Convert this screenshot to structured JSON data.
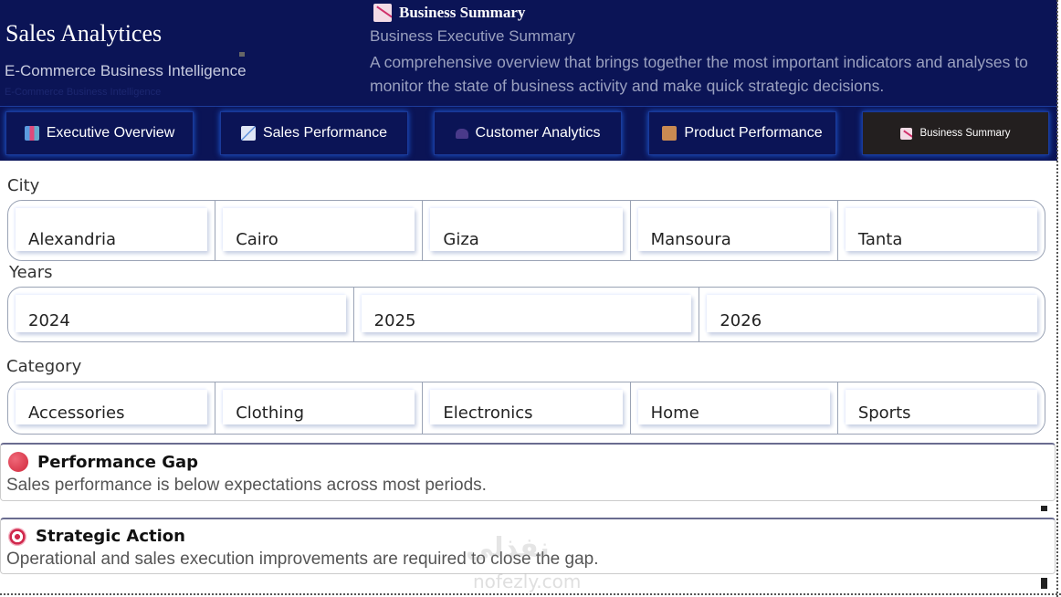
{
  "header": {
    "title": "Sales Analytices",
    "subtitle": "E-Commerce Business Intelligence",
    "subtitle_shadow": "E-Commerce Business Intelligence",
    "summary_title": "Business Summary",
    "summary_subtitle": "Business Executive Summary",
    "summary_description": "A comprehensive overview that brings together the most important indicators and analyses to monitor the state of business activity and make quick strategic decisions."
  },
  "nav": {
    "tabs": [
      {
        "label": "Executive Overview",
        "icon": "bar-chart-icon"
      },
      {
        "label": "Sales Performance",
        "icon": "line-chart-icon"
      },
      {
        "label": "Customer Analytics",
        "icon": "users-icon"
      },
      {
        "label": "Product Performance",
        "icon": "package-icon"
      },
      {
        "label": "Business Summary",
        "icon": "chart-decreasing-icon",
        "active": true
      }
    ]
  },
  "slicers": {
    "city": {
      "label": "City",
      "options": [
        "Alexandria",
        "Cairo",
        "Giza",
        "Mansoura",
        "Tanta"
      ]
    },
    "years": {
      "label": "Years",
      "options": [
        "2024",
        "2025",
        "2026"
      ]
    },
    "category": {
      "label": "Category",
      "options": [
        "Accessories",
        "Clothing",
        "Electronics",
        "Home",
        "Sports"
      ]
    }
  },
  "cards": [
    {
      "title": "Performance Gap",
      "icon": "red-circle-icon",
      "text": "Sales performance is below expectations across most periods."
    },
    {
      "title": "Strategic Action",
      "icon": "target-icon",
      "text": "Operational and sales execution improvements are required to close the gap."
    }
  ],
  "watermark": {
    "arabic": "نفذلي",
    "latin": "nofezly.com"
  }
}
